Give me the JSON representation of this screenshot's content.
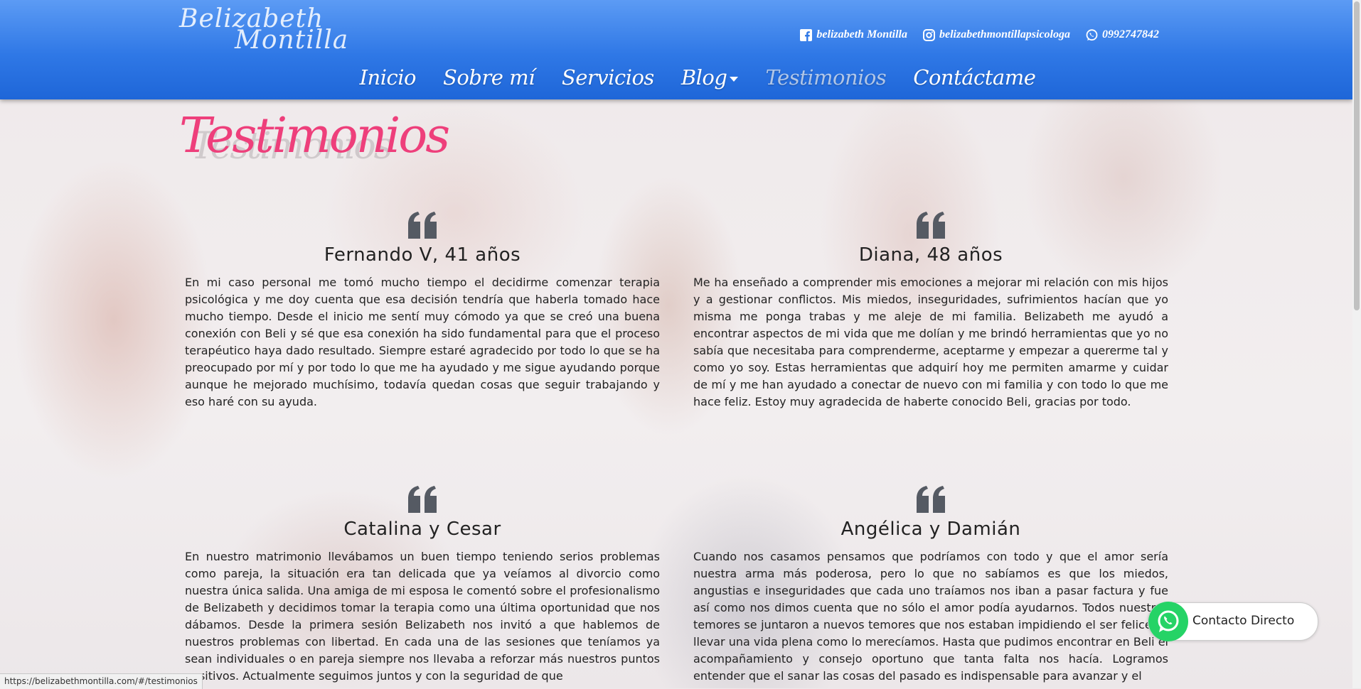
{
  "header": {
    "logo_text_line1": "Belizabeth",
    "logo_text_line2": "Montilla",
    "contacts": [
      {
        "icon": "facebook-icon",
        "label": "belizabeth Montilla"
      },
      {
        "icon": "instagram-icon",
        "label": "belizabethmontillapsicologa"
      },
      {
        "icon": "whatsapp-icon",
        "label": "0992747842"
      }
    ],
    "nav": [
      {
        "label": "Inicio"
      },
      {
        "label": "Sobre mí"
      },
      {
        "label": "Servicios"
      },
      {
        "label": "Blog"
      },
      {
        "label": "Testimonios",
        "active": true
      },
      {
        "label": "Contáctame"
      }
    ]
  },
  "page": {
    "title": "Testimonios"
  },
  "testimonials": [
    {
      "name": "Fernando V, 41 años",
      "text": "En mi caso personal me tomó mucho tiempo el decidirme comenzar terapia psicológica y me doy cuenta que esa decisión tendría que haberla tomado hace mucho tiempo. Desde el inicio me sentí muy cómodo ya que se creó una buena conexión con Beli y sé que esa conexión ha sido fundamental para que el proceso terapéutico haya dado resultado. Siempre estaré agradecido por todo lo que se ha preocupado por mí y por todo lo que me ha ayudado y me sigue ayudando porque aunque he mejorado muchísimo, todavía quedan cosas que seguir trabajando y eso haré con su ayuda."
    },
    {
      "name": "Diana, 48 años",
      "text": "Me ha enseñado a comprender mis emociones a mejorar mi relación con mis hijos y a gestionar conflictos. Mis miedos, inseguridades, sufrimientos hacían que yo misma me ponga trabas y me aleje de mi familia. Belizabeth me ayudó a encontrar aspectos de mi vida que me dolían y me brindó herramientas que yo no sabía que necesitaba para comprenderme, aceptarme y empezar a quererme tal y como yo soy. Estas herramientas que adquirí hoy me permiten amarme y cuidar de mí y me han ayudado a conectar de nuevo con mi familia y con todo lo que me hace feliz. Estoy muy agradecida de haberte conocido Beli, gracias por todo."
    },
    {
      "name": "Catalina y Cesar",
      "text": "En nuestro matrimonio llevábamos un buen tiempo teniendo serios problemas como pareja, la situación era tan delicada que ya veíamos al divorcio como nuestra única salida. Una amiga de mi esposa le comentó sobre el profesionalismo de Belizabeth y decidimos tomar la terapia como una última oportunidad que nos dábamos. Desde la primera sesión Belizabeth nos invitó a que hablemos de nuestros problemas con libertad. En cada una de las sesiones que teníamos ya sean individuales o en pareja siempre nos llevaba a reforzar más nuestros puntos positivos. Actualmente seguimos juntos y con la seguridad de que"
    },
    {
      "name": "Angélica y Damián",
      "text": "Cuando nos casamos pensamos que podríamos con todo y que el amor sería nuestra arma más poderosa, pero lo que no sabíamos es que los miedos, angustias e inseguridades que cada uno traíamos nos iban a pasar factura y fue así como nos dimos cuenta que no sólo el amor podía ayudarnos. Todos nuestros temores se juntaron a nuevos temores que nos estaban impidiendo el ser felices y llevar una vida plena como lo merecíamos. Hasta que pudimos encontrar en Beli el acompañamiento y consejo oportuno que tanta falta nos hacía. Logramos entender que el sanar las cosas del pasado es indispensable para avanzar y el"
    }
  ],
  "whatsapp_float": {
    "label": "Contacto Directo"
  },
  "status_bar": {
    "url": "https://belizabethmontilla.com/#/testimonios"
  },
  "colors": {
    "header_top": "#5c9bf4",
    "header_bottom": "#1e66d8",
    "title_pink": "#ee3f7b",
    "whatsapp_green": "#25d366"
  }
}
